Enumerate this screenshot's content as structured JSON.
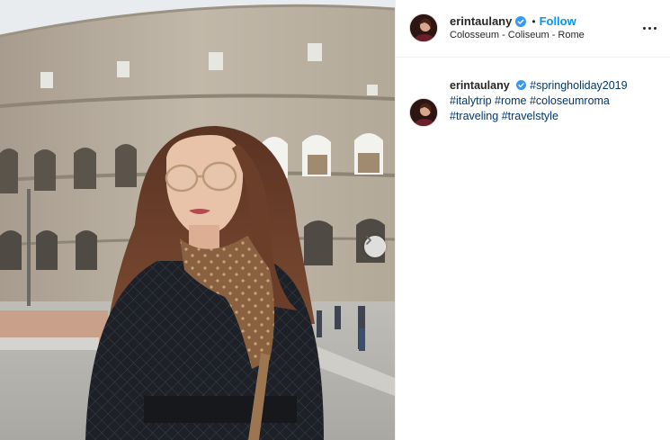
{
  "post": {
    "author": {
      "username": "erintaulany",
      "verified": true,
      "follow_label": "Follow",
      "separator": "•",
      "location": "Colosseum - Coliseum - Rome"
    },
    "more_icon": "more-options-icon",
    "photo": {
      "next_icon": "chevron-right-icon"
    },
    "caption": {
      "username": "erintaulany",
      "verified": true,
      "hashtags": [
        "#springholiday2019",
        "#italytrip",
        "#rome",
        "#coloseumroma",
        "#traveling",
        "#travelstyle"
      ]
    },
    "colors": {
      "link_blue": "#0095f6",
      "hashtag_blue": "#00376b",
      "verified_badge": "#3897f0",
      "text": "#262626",
      "divider": "#efefef"
    }
  }
}
